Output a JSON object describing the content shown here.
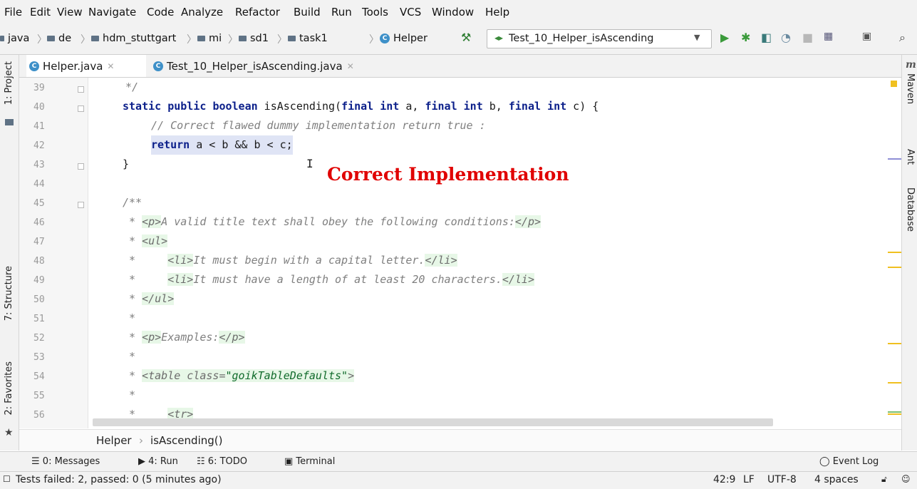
{
  "menu": [
    "File",
    "Edit",
    "View",
    "Navigate",
    "Code",
    "Analyze",
    "Refactor",
    "Build",
    "Run",
    "Tools",
    "VCS",
    "Window",
    "Help"
  ],
  "breadcrumbs": [
    "java",
    "de",
    "hdm_stuttgart",
    "mi",
    "sd1",
    "task1",
    "Helper"
  ],
  "run_config": "Test_10_Helper_isAscending",
  "tabs": [
    {
      "label": "Helper.java",
      "active": true
    },
    {
      "label": "Test_10_Helper_isAscending.java",
      "active": false
    }
  ],
  "side_left": [
    "1: Project",
    "7: Structure",
    "2: Favorites"
  ],
  "side_right": [
    "Maven",
    "Ant",
    "Database"
  ],
  "maven_glyph": "m",
  "code": {
    "line_numbers": [
      "39",
      "40",
      "41",
      "42",
      "43",
      "44",
      "45",
      "46",
      "47",
      "48",
      "49",
      "50",
      "51",
      "52",
      "53",
      "54",
      "55",
      "56"
    ],
    "l39": "*/",
    "l40": {
      "k1": "static",
      "k2": "public",
      "k3": "boolean",
      "name": " isAscending(",
      "k4": "final",
      "k5": "int",
      "p1": " a, ",
      "k6": "final",
      "k7": "int",
      "p2": " b, ",
      "k8": "final",
      "k9": "int",
      "p3": " c) {"
    },
    "l41": "// Correct flawed dummy implementation return true :",
    "l42": {
      "kw": "return",
      "rest": " a < b && b < c;"
    },
    "l43": "}",
    "l45": "/**",
    "l46": {
      "pre": " * ",
      "t1": "<p>",
      "txt": "A valid title text shall obey the following conditions:",
      "t2": "</p>"
    },
    "l47": {
      "pre": " * ",
      "t1": "<ul>"
    },
    "l48": {
      "pre": " *     ",
      "t1": "<li>",
      "txt": "It must begin with a capital letter.",
      "t2": "</li>"
    },
    "l49": {
      "pre": " *     ",
      "t1": "<li>",
      "txt": "It must have a length of at least 20 characters.",
      "t2": "</li>"
    },
    "l50": {
      "pre": " * ",
      "t1": "</ul>"
    },
    "l51": " *",
    "l52": {
      "pre": " * ",
      "t1": "<p>",
      "txt": "Examples:",
      "t2": "</p>"
    },
    "l53": " *",
    "l54": {
      "pre": " * ",
      "t1": "<table class=",
      "val": "\"goikTableDefaults\"",
      "t2": ">"
    },
    "l55": " *",
    "l56": {
      "pre": " *     ",
      "t1": "<tr>"
    }
  },
  "annotation": "Correct Implementation",
  "breadcrumb_bar": {
    "cls": "Helper",
    "sep": "›",
    "method": "isAscending()"
  },
  "bottom_tools": [
    "0: Messages",
    "4: Run",
    "6: TODO",
    "Terminal"
  ],
  "event_log": "Event Log",
  "status": {
    "message": "Tests failed: 2, passed: 0 (5 minutes ago)",
    "position": "42:9",
    "line_sep": "LF",
    "encoding": "UTF-8",
    "indent": "4 spaces"
  },
  "colors": {
    "keyword": "#0b1f8a",
    "comment": "#7f7f7f",
    "annotation": "#e00000",
    "current_line": "#fbf6dc"
  }
}
